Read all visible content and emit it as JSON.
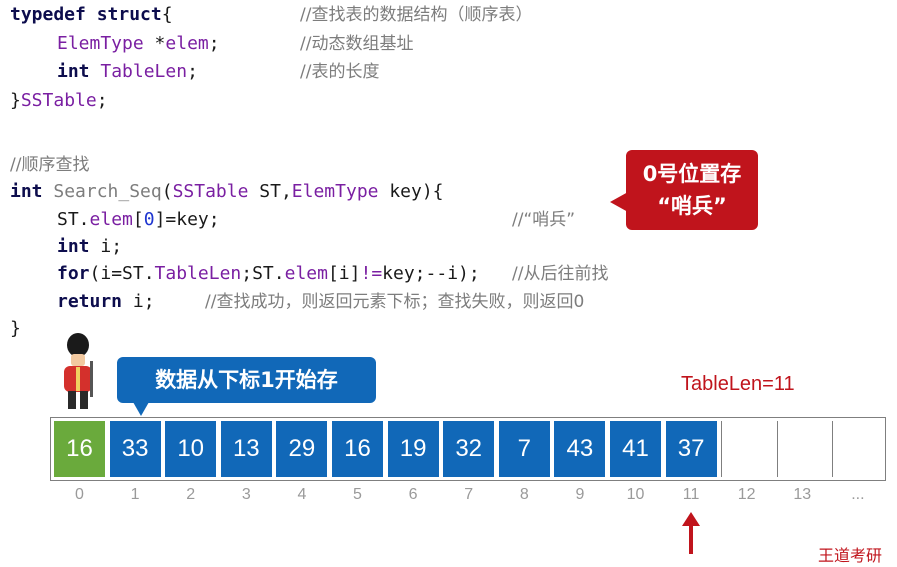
{
  "code": {
    "l1": {
      "kw": "typedef struct",
      "rest": "{",
      "comment": "//查找表的数据结构（顺序表）"
    },
    "l2": {
      "type": "ElemType",
      "rest": " *",
      "field": "elem",
      "end": ";",
      "comment": "//动态数组基址"
    },
    "l3": {
      "kw": "int",
      "field": "TableLen",
      "end": ";",
      "comment": "//表的长度"
    },
    "l4": {
      "a": "}",
      "type": "SSTable",
      "end": ";"
    },
    "l5": {
      "comment": "//顺序查找"
    },
    "l6": {
      "kw": "int",
      "fn": "Search_Seq",
      "a": "(",
      "t1": "SSTable",
      "b": " ST,",
      "t2": "ElemType",
      "c": " key){"
    },
    "l7": {
      "a": "ST.",
      "field": "elem",
      "b": "[",
      "num": "0",
      "c": "]=key;",
      "comment": "//“哨兵”"
    },
    "l8": {
      "kw": "int",
      "rest": " i;"
    },
    "l9": {
      "kw": "for",
      "a": "(i=ST.",
      "f1": "TableLen",
      "b": ";ST.",
      "f2": "elem",
      "c": "[i]",
      "op": "!=",
      "d": "key;--i);",
      "comment": "//从后往前找"
    },
    "l10": {
      "kw": "return",
      "rest": " i;",
      "comment": "//查找成功，则返回元素下标；查找失败，则返回0"
    },
    "l11": {
      "a": "}"
    }
  },
  "callouts": {
    "red_line1": "0号位置存",
    "red_line2": "“哨兵”",
    "blue": "数据从下标1开始存",
    "tablelen": "TableLen=11"
  },
  "array": {
    "values": [
      "16",
      "33",
      "10",
      "13",
      "29",
      "16",
      "19",
      "32",
      "7",
      "43",
      "41",
      "37",
      "",
      "",
      ""
    ],
    "indices": [
      "0",
      "1",
      "2",
      "3",
      "4",
      "5",
      "6",
      "7",
      "8",
      "9",
      "10",
      "11",
      "12",
      "13",
      "..."
    ]
  },
  "brand": "王道考研",
  "colors": {
    "blue": "#1168b8",
    "green": "#6aaa3c",
    "red": "#c0141c"
  }
}
